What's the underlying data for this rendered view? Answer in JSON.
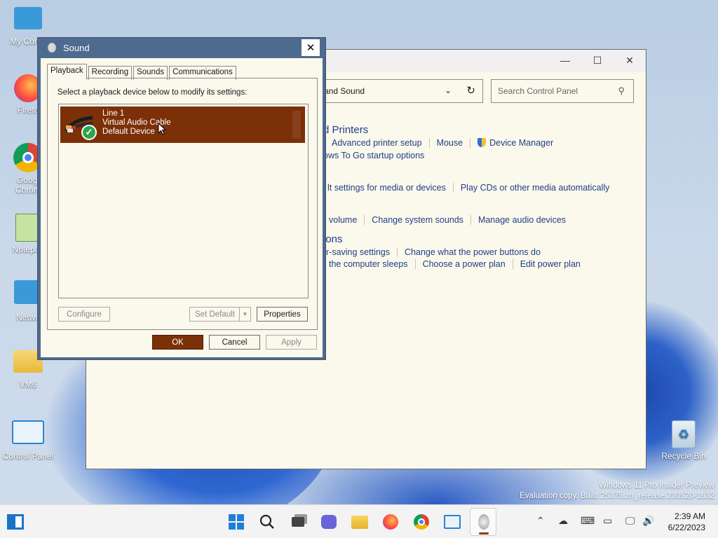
{
  "desktop": {
    "icons": [
      {
        "label": "My Comp"
      },
      {
        "label": "Firefo"
      },
      {
        "label": "Googl Chrom"
      },
      {
        "label": "Notepac"
      },
      {
        "label": "Netwo"
      },
      {
        "label": "VM6"
      },
      {
        "label": "Control Panel"
      },
      {
        "label": "Recycle Bin"
      }
    ],
    "watermark_line1": "Windows 11 Pro Insider Preview",
    "watermark_line2": "Evaluation copy. Build 25375.zn_release.230520-1632"
  },
  "control_panel": {
    "address_text": "and Sound",
    "search_placeholder": "Search Control Panel",
    "heading_devices": "d Printers",
    "links_devices_row1": [
      "Advanced printer setup",
      "Mouse",
      "Device Manager"
    ],
    "links_devices_row2": [
      "ows To Go startup options"
    ],
    "links_autoplay": [
      "lt settings for media or devices",
      "Play CDs or other media automatically"
    ],
    "links_sound": [
      "volume",
      "Change system sounds",
      "Manage audio devices"
    ],
    "heading_power": "ions",
    "links_power_row1": [
      "r-saving settings",
      "Change what the power buttons do"
    ],
    "links_power_row2": [
      "the computer sleeps",
      "Choose a power plan",
      "Edit power plan"
    ]
  },
  "sound_dialog": {
    "title": "Sound",
    "close_glyph": "✕",
    "tabs": [
      "Playback",
      "Recording",
      "Sounds",
      "Communications"
    ],
    "instruction": "Select a playback device below to modify its settings:",
    "device": {
      "name": "Line 1",
      "description": "Virtual Audio Cable",
      "status": "Default Device"
    },
    "buttons": {
      "configure": "Configure",
      "set_default": "Set Default",
      "properties": "Properties",
      "ok": "OK",
      "cancel": "Cancel",
      "apply": "Apply"
    }
  },
  "taskbar": {
    "clock_time": "2:39 AM",
    "clock_date": "6/22/2023"
  },
  "colors": {
    "accent": "#7c3008",
    "dialog_frame": "#4e6a8e",
    "window_bg": "#fbf8ec"
  }
}
